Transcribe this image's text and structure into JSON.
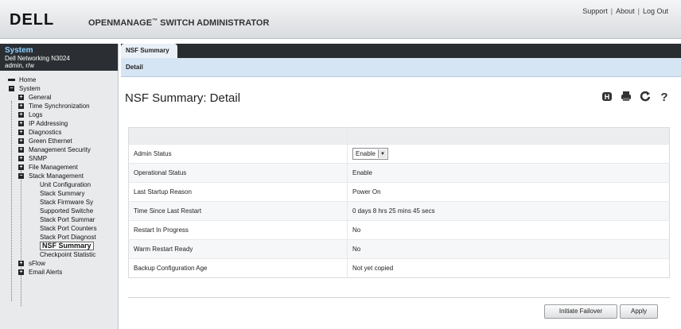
{
  "header": {
    "logo": "DELL",
    "title": "OPENMANAGE",
    "title_tm": "™",
    "title_rest": " SWITCH ADMINISTRATOR",
    "links": [
      "Support",
      "About",
      "Log Out"
    ]
  },
  "system": {
    "title": "System",
    "model": "Dell Networking N3024",
    "user": "admin, r/w"
  },
  "tree": {
    "home": "Home",
    "system": "System",
    "general": "General",
    "time_sync": "Time Synchronization",
    "logs": "Logs",
    "ip_addressing": "IP Addressing",
    "diagnostics": "Diagnostics",
    "green_ethernet": "Green Ethernet",
    "mgmt_security": "Management Security",
    "snmp": "SNMP",
    "file_mgmt": "File Management",
    "stack_mgmt": "Stack Management",
    "unit_config": "Unit Configuration",
    "stack_summary": "Stack Summary",
    "stack_firmware": "Stack Firmware Sy",
    "supported_switches": "Supported Switche",
    "stack_port_summary": "Stack Port Summar",
    "stack_port_counters": "Stack Port Counters",
    "stack_port_diag": "Stack Port Diagnost",
    "nsf_summary": "NSF Summary",
    "checkpoint_stats": "Checkpoint Statistic",
    "sflow": "sFlow",
    "email_alerts": "Email Alerts"
  },
  "tabs": {
    "active": "NSF Summary",
    "sub": "Detail"
  },
  "page": {
    "title": "NSF Summary: Detail"
  },
  "rows": [
    {
      "label": "Admin Status",
      "value": "Enable"
    },
    {
      "label": "Operational Status",
      "value": "Enable"
    },
    {
      "label": "Last Startup Reason",
      "value": "Power On"
    },
    {
      "label": "Time Since Last Restart",
      "value": "0 days 8 hrs 25 mins 45 secs"
    },
    {
      "label": "Restart In Progress",
      "value": "No"
    },
    {
      "label": "Warm Restart Ready",
      "value": "No"
    },
    {
      "label": "Backup Configuration Age",
      "value": "Not yet copied"
    }
  ],
  "buttons": {
    "initiate_failover": "Initiate Failover",
    "apply": "Apply"
  }
}
